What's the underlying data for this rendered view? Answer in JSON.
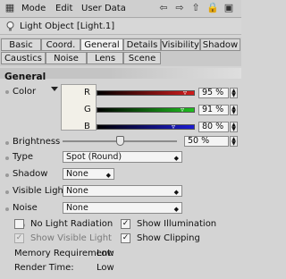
{
  "menubar": {
    "items": [
      "Mode",
      "Edit",
      "User Data"
    ]
  },
  "title": {
    "object_name": "Light Object [Light.1]"
  },
  "tabs": {
    "row1": [
      "Basic",
      "Coord.",
      "General",
      "Details",
      "Visibility",
      "Shadow"
    ],
    "row2": [
      "Caustics",
      "Noise",
      "Lens",
      "Scene"
    ],
    "active": "General"
  },
  "section": {
    "title": "General"
  },
  "color": {
    "label": "Color",
    "swatch": "#f2f0e8",
    "channels": [
      {
        "letter": "R",
        "value": "95 %",
        "bar_from": "#000000",
        "bar_to": "#d21c1c"
      },
      {
        "letter": "G",
        "value": "91 %",
        "bar_from": "#000000",
        "bar_to": "#1fbf1f"
      },
      {
        "letter": "B",
        "value": "80 %",
        "bar_from": "#000000",
        "bar_to": "#1c1cd4"
      }
    ]
  },
  "brightness": {
    "label": "Brightness",
    "value": "50 %",
    "fraction": 0.5
  },
  "type": {
    "label": "Type",
    "value": "Spot (Round)"
  },
  "shadow": {
    "label": "Shadow",
    "value": "None"
  },
  "visible_light": {
    "label": "Visible Light",
    "value": "None"
  },
  "noise": {
    "label": "Noise",
    "value": "None"
  },
  "checks": {
    "no_light_radiation": {
      "label": "No Light Radiation",
      "checked": false
    },
    "show_illumination": {
      "label": "Show Illumination",
      "checked": true
    },
    "show_visible_light": {
      "label": "Show Visible Light",
      "checked": true
    },
    "show_clipping": {
      "label": "Show Clipping",
      "checked": true
    }
  },
  "memory": {
    "label": "Memory Requirement:",
    "value": "Low"
  },
  "render_time": {
    "label": "Render Time:",
    "value": "Low"
  }
}
